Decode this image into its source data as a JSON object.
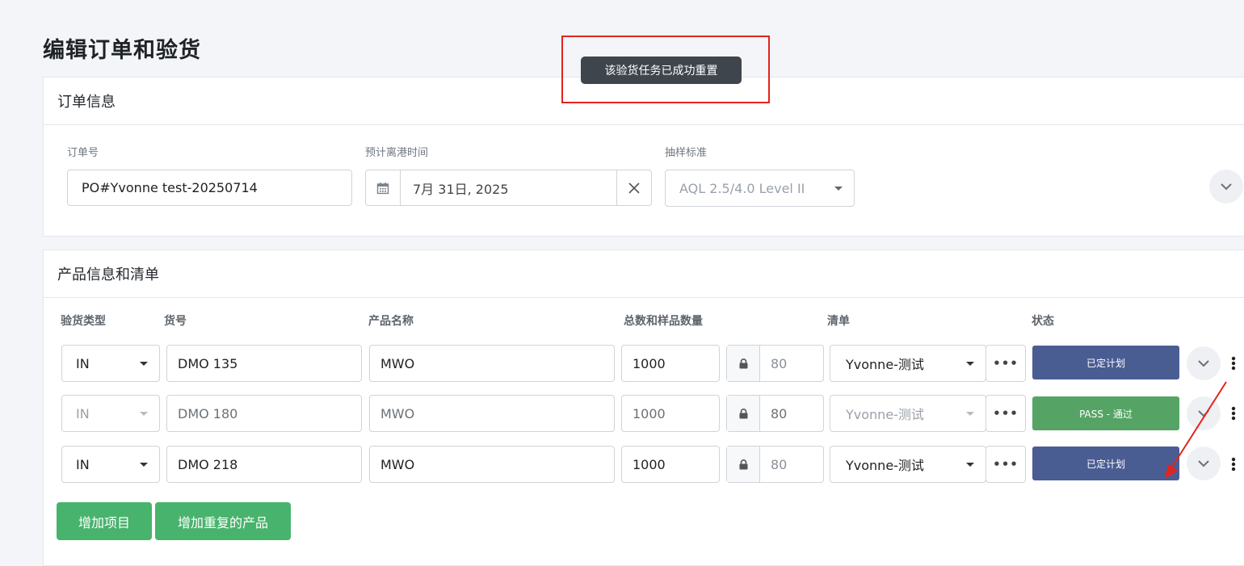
{
  "page_title": "编辑订单和验货",
  "toast": {
    "message": "该验货任务已成功重置"
  },
  "order_info": {
    "section_title": "订单信息",
    "order_no": {
      "label": "订单号",
      "value": "PO#Yvonne test-20250714"
    },
    "etd": {
      "label": "预计离港时间",
      "value": "7月 31日, 2025"
    },
    "sampling": {
      "label": "抽样标准",
      "value": "AQL 2.5/4.0 Level II"
    }
  },
  "products": {
    "section_title": "产品信息和清单",
    "columns": {
      "type": "验货类型",
      "sku": "货号",
      "name": "产品名称",
      "qty": "总数和样品数量",
      "checklist": "清单",
      "status": "状态"
    },
    "rows": [
      {
        "type": "IN",
        "sku": "DMO 135",
        "name": "MWO",
        "total": "1000",
        "sample": "80",
        "checklist": "Yvonne-测试",
        "status": "已定计划",
        "status_color": "#4a5d93",
        "disabled": false
      },
      {
        "type": "IN",
        "sku": "DMO 180",
        "name": "MWO",
        "total": "1000",
        "sample": "80",
        "checklist": "Yvonne-测试",
        "status": "PASS - 通过",
        "status_color": "#55a465",
        "disabled": true
      },
      {
        "type": "IN",
        "sku": "DMO 218",
        "name": "MWO",
        "total": "1000",
        "sample": "80",
        "checklist": "Yvonne-测试",
        "status": "已定计划",
        "status_color": "#4a5d93",
        "disabled": false
      }
    ],
    "add_item_label": "增加项目",
    "add_duplicate_label": "增加重复的产品"
  },
  "icons": {
    "calendar": "calendar-icon",
    "clear": "close-icon",
    "lock": "lock-icon",
    "expand": "chevron-down-icon",
    "more": "ellipsis-icon"
  }
}
